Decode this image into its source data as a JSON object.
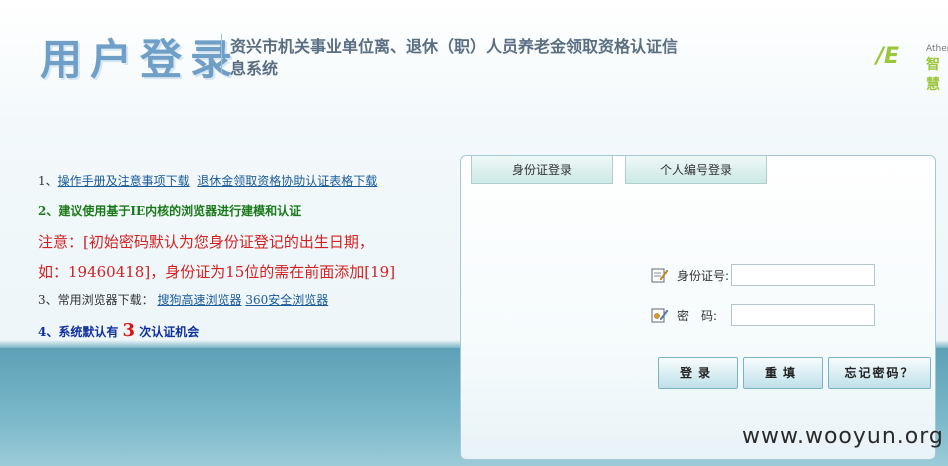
{
  "header": {
    "title": "用户登录",
    "system_name": "资兴市机关事业单位离、退休（职）人员养老金领取资格认证信息系统",
    "brand_mark": "/E",
    "brand_en": "Athen",
    "brand_cn": "智慧"
  },
  "notes": {
    "line1_prefix": "1、",
    "line1_link1": "操作手册及注意事项下载",
    "line1_link2": "退休金领取资格协助认证表格下载",
    "line2": "2、建议使用基于IE内核的浏览器进行建模和认证",
    "line3": "注意：[初始密码默认为您身份证登记的出生日期，",
    "line4": "如：19460418]，身份证为15位的需在前面添加[19]",
    "line5_prefix": "3、常用浏览器下载：",
    "line5_link1": "搜狗高速浏览器",
    "line5_link2": "360安全浏览器",
    "line6_prefix": "4、系统默认有",
    "line6_number": "3",
    "line6_suffix": "次认证机会"
  },
  "login": {
    "tabs": [
      "身份证登录",
      "个人编号登录"
    ],
    "id_label": "身份证号:",
    "id_value": "",
    "password_label": "密　码:",
    "password_value": "",
    "login_button": "登录",
    "reset_button": "重填",
    "forgot_button": "忘记密码？"
  },
  "watermark": "www.wooyun.org",
  "colors": {
    "title": "#6f9fc6",
    "link": "#1a5a99",
    "notice_red": "#d42020",
    "advice_green": "#1a7a1a",
    "band": "#5ea0b6"
  }
}
